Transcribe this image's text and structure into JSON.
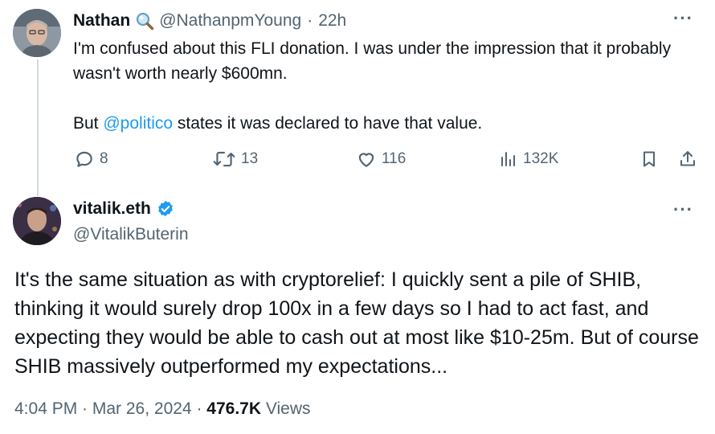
{
  "reply_parent": {
    "author_name": "Nathan",
    "author_handle": "@NathanpmYoung",
    "separator": "·",
    "time_ago": "22h",
    "more_label": "···",
    "body_line1": "I'm confused about this FLI donation. I was under the impression that it probably wasn't worth nearly $600mn.",
    "body_line2_prefix": "But ",
    "body_mention": "@politico",
    "body_line2_suffix": " states it was declared to have that value.",
    "actions": {
      "replies": "8",
      "reposts": "13",
      "likes": "116",
      "views": "132K"
    }
  },
  "main_tweet": {
    "author_name": "vitalik.eth",
    "author_handle": "@VitalikButerin",
    "verified": true,
    "more_label": "···",
    "body": "It's the same situation as with cryptorelief: I quickly sent a pile of SHIB, thinking it would surely drop 100x in a few days so I had to act fast, and expecting they would be able to cash out at most like $10-25m.  But of course SHIB massively outperformed my expectations...",
    "timestamp": "4:04 PM · Mar 26, 2024 ·",
    "views_count": "476.7K",
    "views_label": "Views"
  },
  "icons": {
    "nathan_badge": "magnifying-glass-icon",
    "verified_badge": "verified-badge-icon",
    "reply": "reply-icon",
    "repost": "repost-icon",
    "like": "heart-icon",
    "views": "analytics-icon",
    "bookmark": "bookmark-icon",
    "share": "share-icon"
  },
  "colors": {
    "text_primary": "#0f1419",
    "text_secondary": "#536471",
    "accent": "#1d9bf0",
    "thread_line": "#cfd9de"
  }
}
